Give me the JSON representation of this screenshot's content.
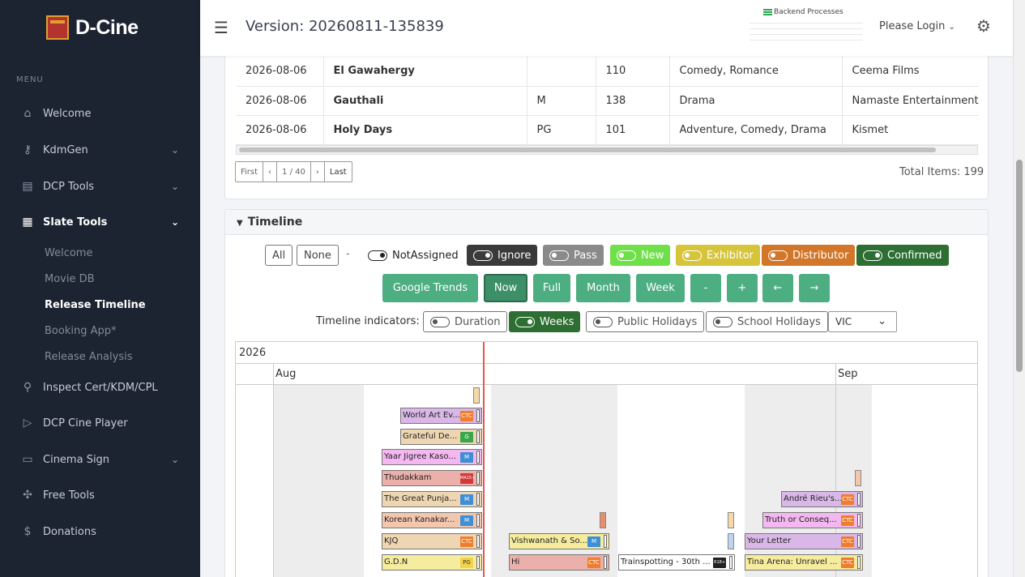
{
  "brand": {
    "name": "D-Cine"
  },
  "sidebar": {
    "menu_heading": "MENU",
    "items": [
      {
        "label": "Welcome",
        "icon": "home-icon"
      },
      {
        "label": "KdmGen",
        "icon": "key-icon"
      },
      {
        "label": "DCP Tools",
        "icon": "file-icon"
      },
      {
        "label": "Slate Tools",
        "icon": "film-icon"
      },
      {
        "label": "Inspect Cert/KDM/CPL",
        "icon": "search-icon"
      },
      {
        "label": "DCP Cine Player",
        "icon": "play-icon"
      },
      {
        "label": "Cinema Sign",
        "icon": "tv-icon"
      },
      {
        "label": "Free Tools",
        "icon": "puzzle-icon"
      },
      {
        "label": "Donations",
        "icon": "dollar-icon"
      }
    ],
    "sub_items": [
      "Welcome",
      "Movie DB",
      "Release Timeline",
      "Booking App*",
      "Release Analysis"
    ]
  },
  "header": {
    "version": "Version: 20260811-135839",
    "backend": "Backend Processes",
    "login": "Please Login"
  },
  "table": {
    "rows": [
      [
        "2026-08-06",
        "El Gawahergy",
        "",
        "110",
        "Comedy, Romance",
        "Ceema Films"
      ],
      [
        "2026-08-06",
        "Gauthali",
        "M",
        "138",
        "Drama",
        "Namaste Entertainment"
      ],
      [
        "2026-08-06",
        "Holy Days",
        "PG",
        "101",
        "Adventure, Comedy, Drama",
        "Kismet"
      ]
    ]
  },
  "pager": {
    "first": "First",
    "prev": "‹",
    "page": "1 / 40",
    "next": "›",
    "last": "Last",
    "total": "Total Items: 199"
  },
  "timeline": {
    "title": "Timeline",
    "filters": {
      "all": "All",
      "none": "None",
      "dash": "-",
      "not_assigned": "NotAssigned",
      "ignore": "Ignore",
      "pass": "Pass",
      "new": "New",
      "exhibitor": "Exhibitor",
      "distributor": "Distributor",
      "confirmed": "Confirmed"
    },
    "controls": {
      "google_trends": "Google Trends",
      "now": "Now",
      "full": "Full",
      "month": "Month",
      "week": "Week",
      "minus": "-",
      "plus": "+",
      "left": "←",
      "right": "→"
    },
    "indicators": {
      "label": "Timeline indicators:",
      "duration": "Duration",
      "weeks": "Weeks",
      "public_holidays": "Public Holidays",
      "school_holidays": "School Holidays",
      "region": "VIC"
    },
    "year": "2026",
    "months": [
      "Aug",
      "Sep"
    ],
    "events": [
      {
        "title": "World Art Ev...",
        "tag": "CTC"
      },
      {
        "title": "Grateful De...",
        "tag": "G"
      },
      {
        "title": "Yaar Jigree Kaso...",
        "tag": "M"
      },
      {
        "title": "Thudakkam",
        "tag": "MA15+"
      },
      {
        "title": "The Great Punja...",
        "tag": "M"
      },
      {
        "title": "Korean Kanakar...",
        "tag": "M"
      },
      {
        "title": "KJQ",
        "tag": "CTC"
      },
      {
        "title": "G.D.N",
        "tag": "PG"
      },
      {
        "title": "Vishwanath & So...",
        "tag": "M"
      },
      {
        "title": "Hi",
        "tag": "CTC"
      },
      {
        "title": "Trainspotting - 30th ...",
        "tag": "R18+"
      },
      {
        "title": "André Rieu's...",
        "tag": "CTC"
      },
      {
        "title": "Truth or Conseq...",
        "tag": "CTC"
      },
      {
        "title": "Your Letter",
        "tag": "CTC"
      },
      {
        "title": "Tina Arena: Unravel ...",
        "tag": "CTC"
      }
    ]
  },
  "colors": {
    "sidebar_bg": "#1c2331",
    "ignore": "#3a3a3a",
    "pass": "#8a8a8a",
    "new": "#6fe04a",
    "exhibitor": "#d6c43a",
    "distributor": "#d2762a",
    "confirmed": "#2d6e32",
    "controls": "#4dae82",
    "now_line": "#e25a4e"
  }
}
